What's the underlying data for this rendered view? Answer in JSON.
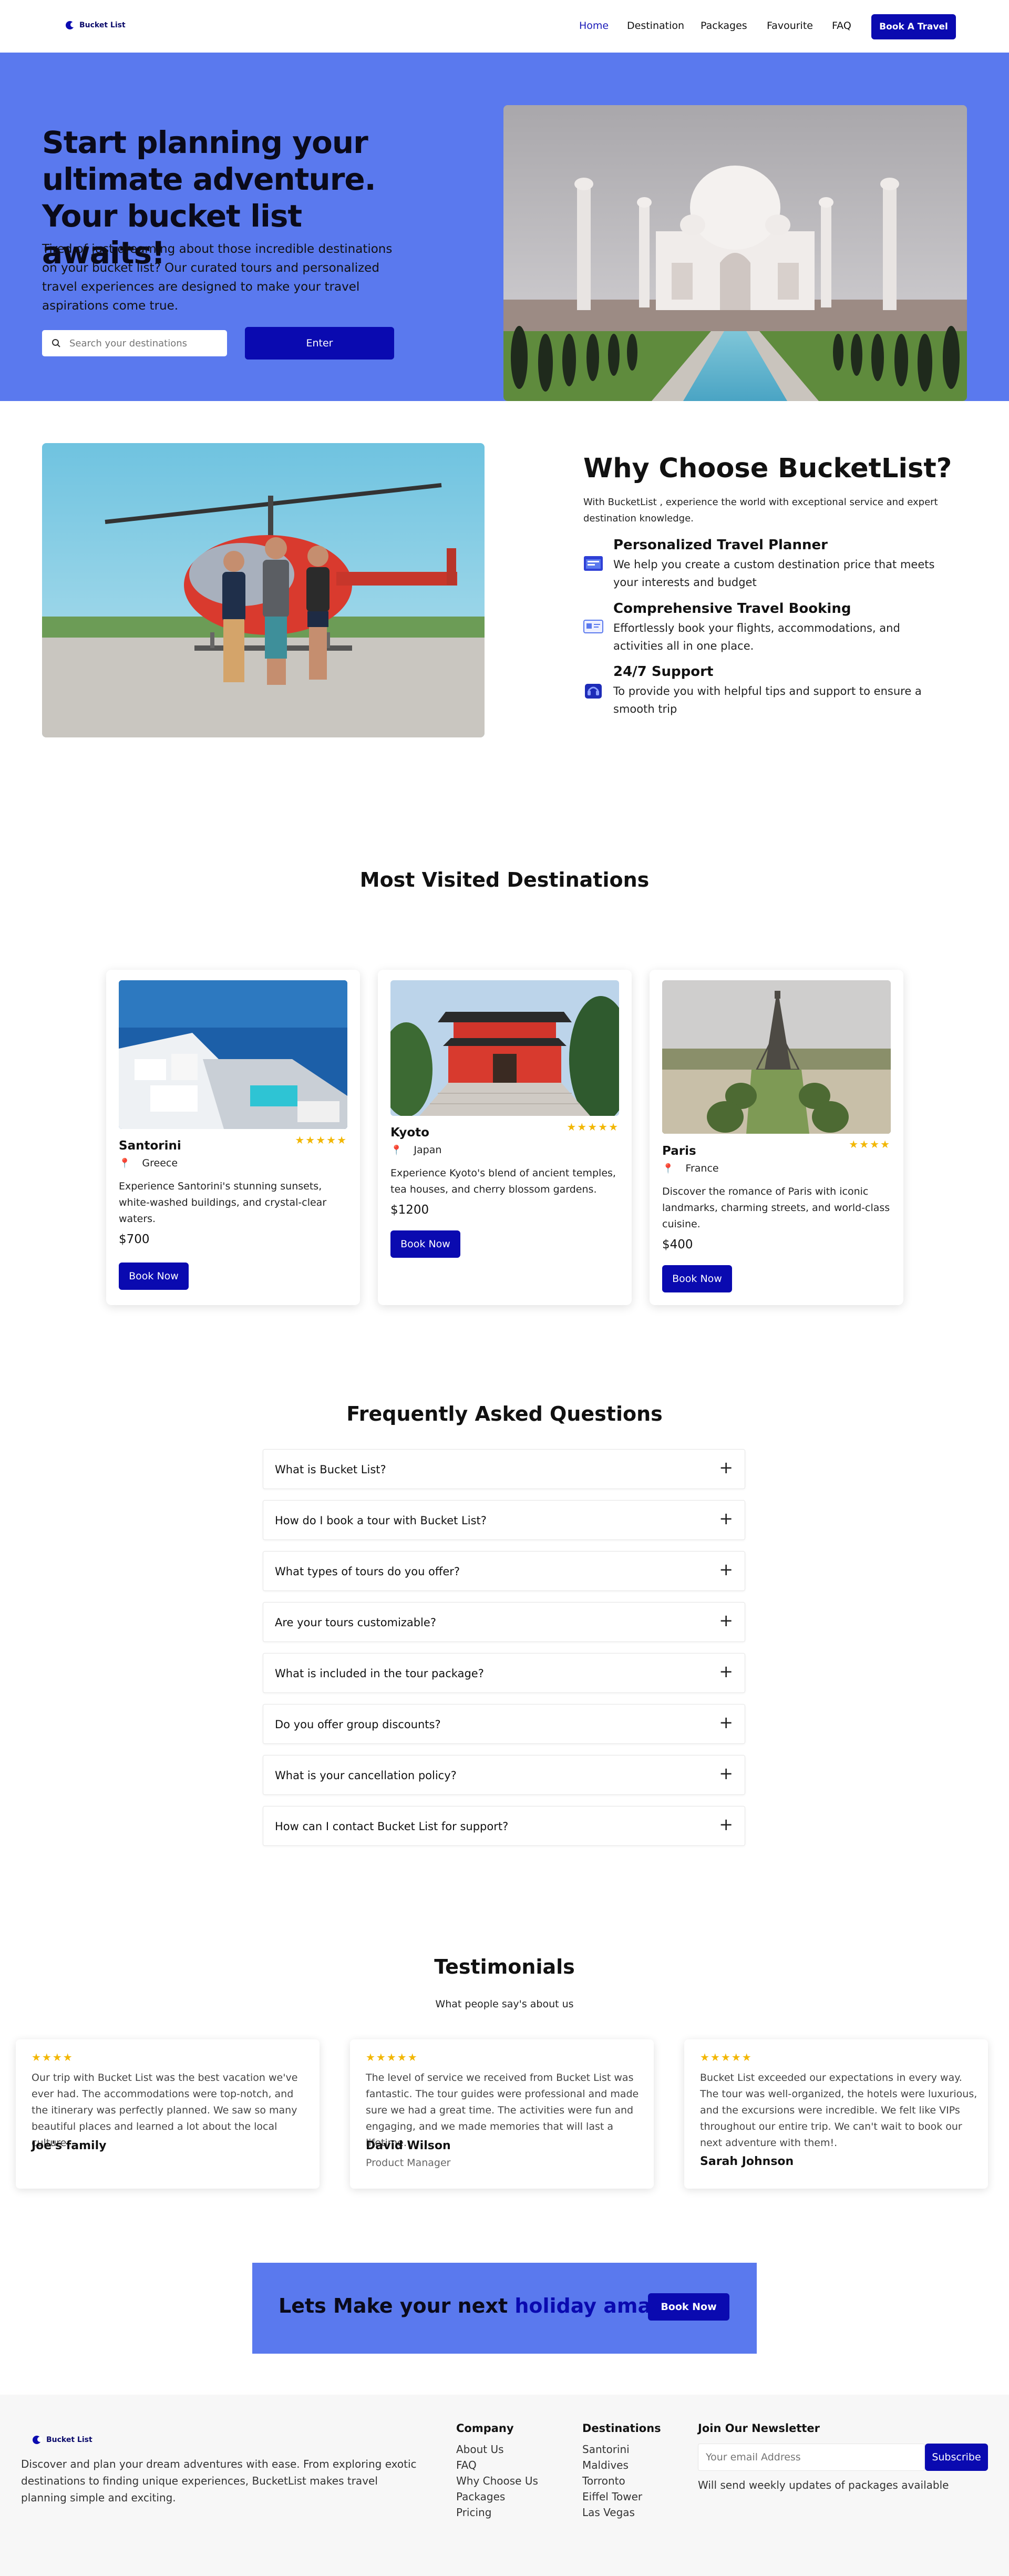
{
  "nav": {
    "logo": "Bucket List",
    "links": [
      "Home",
      "Destination",
      "Packages",
      "Favourite",
      "FAQ"
    ],
    "cta": "Book A Travel"
  },
  "hero": {
    "title": "Start planning your ultimate adventure. Your bucket list awaits!",
    "subtitle": "Tired of just dreaming about those incredible destinations on your bucket list? Our curated tours and personalized travel experiences are designed to make your travel aspirations come true.",
    "search_placeholder": "Search your destinations",
    "enter_label": "Enter"
  },
  "why": {
    "title": "Why Choose BucketList?",
    "intro": "With BucketList , experience the world with exceptional service and expert destination knowledge.",
    "features": [
      {
        "icon": "planner-icon",
        "title": "Personalized Travel Planner",
        "text": "We help you create a custom destination price that meets your interests and budget"
      },
      {
        "icon": "booking-icon",
        "title": "Comprehensive Travel Booking",
        "text": "Effortlessly book your flights, accommodations, and activities all in one place."
      },
      {
        "icon": "support-icon",
        "title": "24/7 Support",
        "text": "To provide you with helpful tips and support to ensure a smooth trip"
      }
    ]
  },
  "destinations": {
    "title": "Most Visited Destinations",
    "book_label": "Book Now",
    "items": [
      {
        "name": "Santorini",
        "country": "Greece",
        "rating": 5,
        "stars": "★★★★★",
        "desc": "Experience Santorini's stunning sunsets, white-washed buildings, and crystal-clear waters.",
        "price": "$700"
      },
      {
        "name": "Kyoto",
        "country": "Japan",
        "rating": 5,
        "stars": "★★★★★",
        "desc": "Experience Kyoto's blend of ancient temples, tea houses, and cherry blossom gardens.",
        "price": "$1200"
      },
      {
        "name": "Paris",
        "country": "France",
        "rating": 4,
        "stars": "★★★★",
        "desc": "Discover the romance of Paris with iconic landmarks, charming streets, and world-class cuisine.",
        "price": "$400"
      }
    ]
  },
  "faq": {
    "title": "Frequently Asked Questions",
    "questions": [
      "What is Bucket List?",
      "How do I book a tour with Bucket List?",
      "What types of tours do you offer?",
      "Are your tours customizable?",
      "What is included in the tour package?",
      "Do you offer group discounts?",
      "What is your cancellation policy?",
      "How can I contact Bucket List for support?"
    ]
  },
  "testimonials": {
    "title": "Testimonials",
    "subtitle": "What people say's about us",
    "items": [
      {
        "rating": 4,
        "stars": "★★★★",
        "text": "Our trip with Bucket List was the best vacation we've ever had. The accommodations were top-notch, and the itinerary was perfectly planned. We saw so many beautiful places and learned a lot about the local culture",
        "name": "Joe's family",
        "role": ""
      },
      {
        "rating": 5,
        "stars": "★★★★★",
        "text": "The level of service we received from Bucket List was fantastic. The tour guides were professional and made sure we had a great time. The activities were fun and engaging, and we made memories that will last a lifetime.",
        "name": "David Wilson",
        "role": "Product Manager"
      },
      {
        "rating": 5,
        "stars": "★★★★★",
        "text": "Bucket List exceeded our expectations in every way. The tour was well-organized, the hotels were luxurious, and the excursions were incredible. We felt like VIPs throughout our entire trip. We can't wait to book our next adventure with them!.",
        "name": "Sarah Johnson",
        "role": ""
      }
    ]
  },
  "cta": {
    "text_plain": "Lets Make your next ",
    "text_highlight": "holiday amazing",
    "button": "Book Now"
  },
  "footer": {
    "logo": "Bucket List",
    "about": "Discover and plan your dream adventures with ease. From exploring exotic destinations to finding unique experiences, BucketList makes travel planning simple and exciting.",
    "company_title": "Company",
    "company_links": [
      "About Us",
      "FAQ",
      "Why Choose Us",
      "Packages",
      "Pricing"
    ],
    "dest_title": "Destinations",
    "dest_links": [
      "Santorini",
      "Maldives",
      "Torronto",
      "Eiffel Tower",
      "Las Vegas"
    ],
    "news_title": "Join Our Newsletter",
    "email_placeholder": "Your email Address",
    "subscribe": "Subscribe",
    "news_note": "Will send weekly updates of packages available"
  },
  "colors": {
    "hero_bg": "#5a79ee",
    "primary": "#0a0ab0",
    "star": "#f2b705"
  }
}
